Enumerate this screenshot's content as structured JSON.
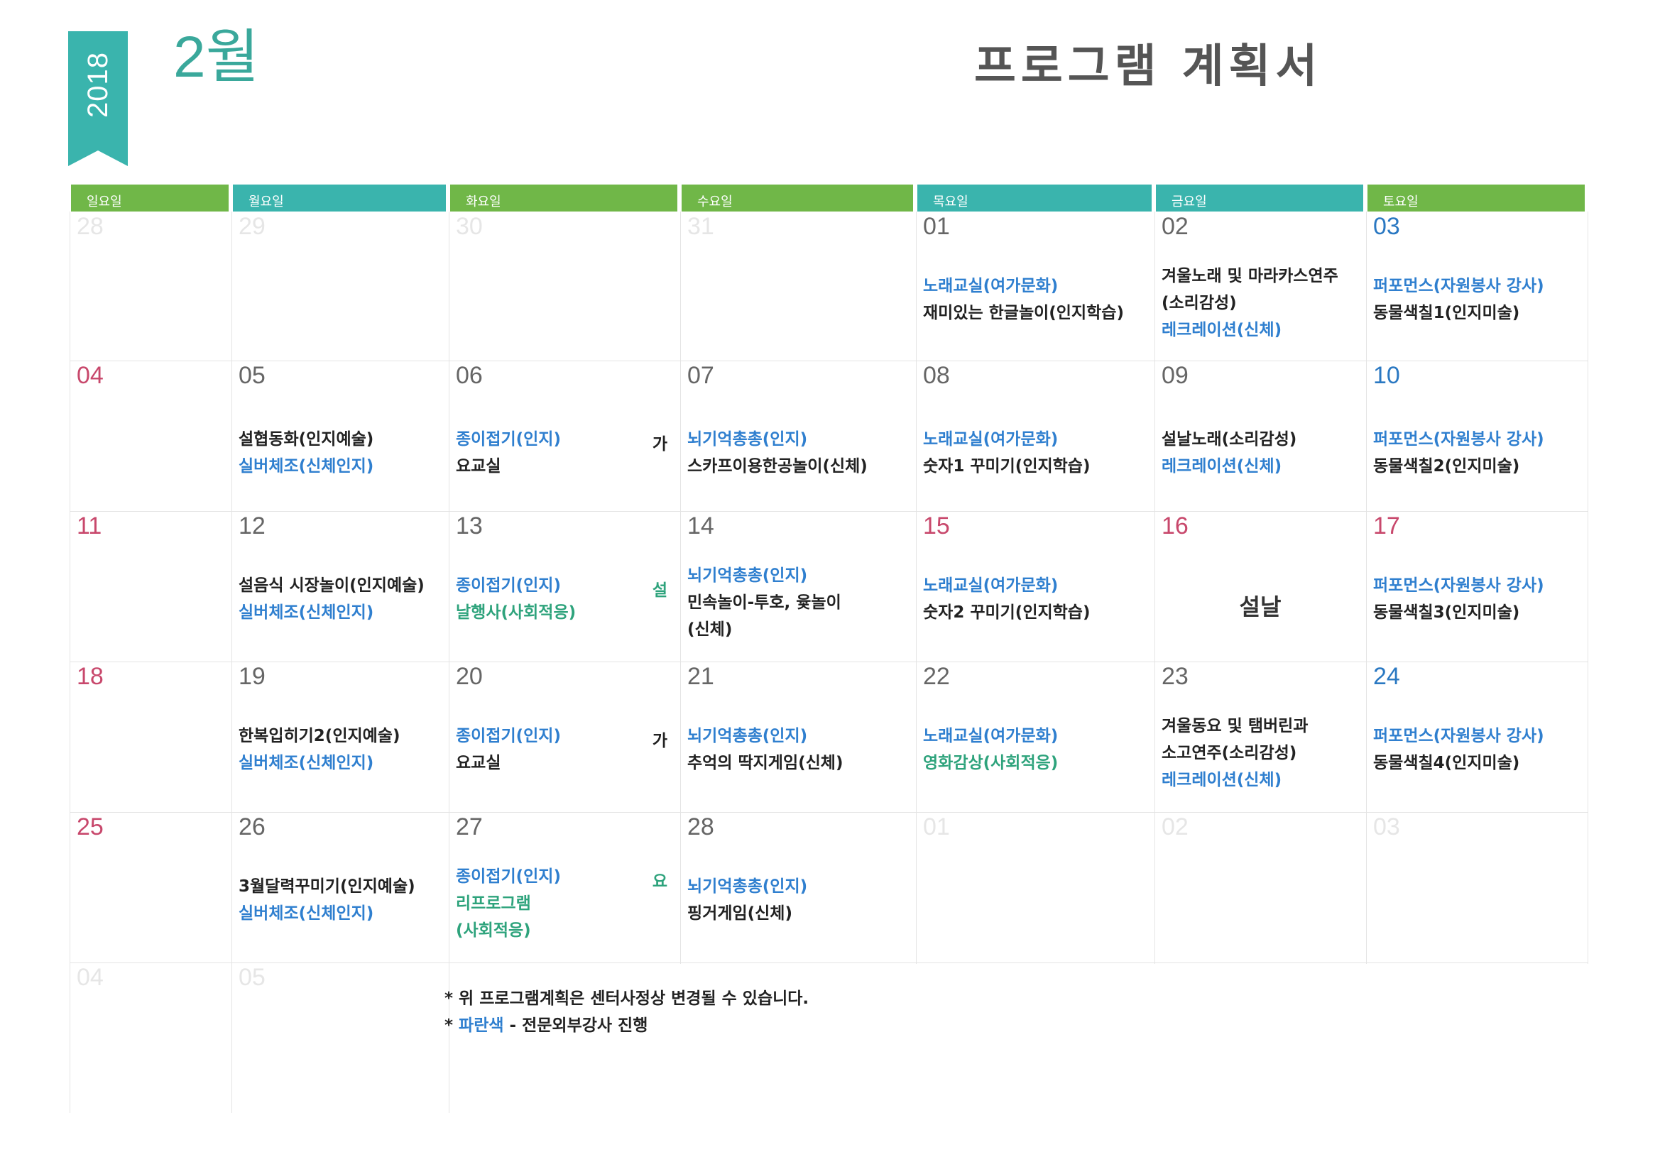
{
  "header": {
    "year": "2018",
    "month": "2월",
    "title": "프로그램 계획서"
  },
  "weekdays": [
    "일요일",
    "월요일",
    "화요일",
    "수요일",
    "목요일",
    "금요일",
    "토요일"
  ],
  "weeks": [
    [
      {
        "day": "28",
        "style": "faint",
        "lines": []
      },
      {
        "day": "29",
        "style": "faint",
        "lines": []
      },
      {
        "day": "30",
        "style": "faint",
        "lines": []
      },
      {
        "day": "31",
        "style": "faint",
        "lines": []
      },
      {
        "day": "01",
        "style": "gray",
        "lines": [
          {
            "t": "노래교실(여가문화)",
            "c": "b"
          },
          {
            "t": "재미있는 한글놀이(인지학습)",
            "c": "k"
          }
        ]
      },
      {
        "day": "02",
        "style": "gray",
        "lines": [
          {
            "t": "겨울노래 및 마라카스연주",
            "c": "k"
          },
          {
            "t": "(소리감성)",
            "c": "k"
          },
          {
            "t": "레크레이션(신체)",
            "c": "b"
          }
        ]
      },
      {
        "day": "03",
        "style": "blue",
        "lines": [
          {
            "t": "퍼포먼스(자원봉사 강사)",
            "c": "b"
          },
          {
            "t": "동물색칠1(인지미술)",
            "c": "k"
          }
        ]
      }
    ],
    [
      {
        "day": "04",
        "style": "red",
        "lines": []
      },
      {
        "day": "05",
        "style": "gray",
        "lines": [
          {
            "t": "설협동화(인지예술)",
            "c": "k"
          },
          {
            "t": "실버체조(신체인지)",
            "c": "b"
          }
        ]
      },
      {
        "day": "06",
        "style": "gray",
        "lines": [
          {
            "t": "종이접기(인지)",
            "c": "b"
          },
          {
            "t": "요교실",
            "c": "k"
          }
        ],
        "side": {
          "t": "가",
          "c": "k"
        }
      },
      {
        "day": "07",
        "style": "gray",
        "lines": [
          {
            "t": "뇌기억총총(인지)",
            "c": "b"
          },
          {
            "t": "스카프이용한공놀이(신체)",
            "c": "k"
          }
        ]
      },
      {
        "day": "08",
        "style": "gray",
        "lines": [
          {
            "t": "노래교실(여가문화)",
            "c": "b"
          },
          {
            "t": "숫자1 꾸미기(인지학습)",
            "c": "k"
          }
        ]
      },
      {
        "day": "09",
        "style": "gray",
        "lines": [
          {
            "t": "설날노래(소리감성)",
            "c": "k"
          },
          {
            "t": "레크레이션(신체)",
            "c": "b"
          }
        ]
      },
      {
        "day": "10",
        "style": "blue",
        "lines": [
          {
            "t": "퍼포먼스(자원봉사 강사)",
            "c": "b"
          },
          {
            "t": "동물색칠2(인지미술)",
            "c": "k"
          }
        ]
      }
    ],
    [
      {
        "day": "11",
        "style": "red",
        "lines": []
      },
      {
        "day": "12",
        "style": "gray",
        "lines": [
          {
            "t": "설음식 시장놀이(인지예술)",
            "c": "k"
          },
          {
            "t": "실버체조(신체인지)",
            "c": "b"
          }
        ]
      },
      {
        "day": "13",
        "style": "gray",
        "lines": [
          {
            "t": "종이접기(인지)",
            "c": "b"
          },
          {
            "t": "날행사(사회적응)",
            "c": "g"
          }
        ],
        "side": {
          "t": "설",
          "c": "g"
        }
      },
      {
        "day": "14",
        "style": "gray",
        "lines": [
          {
            "t": "뇌기억총총(인지)",
            "c": "b"
          },
          {
            "t": "민속놀이-투호, 윷놀이",
            "c": "k"
          },
          {
            "t": "(신체)",
            "c": "k"
          }
        ]
      },
      {
        "day": "15",
        "style": "red",
        "lines": [
          {
            "t": "노래교실(여가문화)",
            "c": "b"
          },
          {
            "t": "숫자2 꾸미기(인지학습)",
            "c": "k"
          }
        ]
      },
      {
        "day": "16",
        "style": "red",
        "lines": [],
        "holiday": "설날"
      },
      {
        "day": "17",
        "style": "red",
        "lines": [
          {
            "t": "퍼포먼스(자원봉사 강사)",
            "c": "b"
          },
          {
            "t": "동물색칠3(인지미술)",
            "c": "k"
          }
        ]
      }
    ],
    [
      {
        "day": "18",
        "style": "red",
        "lines": []
      },
      {
        "day": "19",
        "style": "gray",
        "lines": [
          {
            "t": "한복입히기2(인지예술)",
            "c": "k"
          },
          {
            "t": "실버체조(신체인지)",
            "c": "b"
          }
        ]
      },
      {
        "day": "20",
        "style": "gray",
        "lines": [
          {
            "t": "종이접기(인지)",
            "c": "b"
          },
          {
            "t": "요교실",
            "c": "k"
          }
        ],
        "side": {
          "t": "가",
          "c": "k"
        }
      },
      {
        "day": "21",
        "style": "gray",
        "lines": [
          {
            "t": "뇌기억총총(인지)",
            "c": "b"
          },
          {
            "t": "추억의 딱지게임(신체)",
            "c": "k"
          }
        ]
      },
      {
        "day": "22",
        "style": "gray",
        "lines": [
          {
            "t": "노래교실(여가문화)",
            "c": "b"
          },
          {
            "t": "영화감상(사회적응)",
            "c": "g"
          }
        ]
      },
      {
        "day": "23",
        "style": "gray",
        "lines": [
          {
            "t": "겨울동요 및 탬버린과",
            "c": "k"
          },
          {
            "t": "소고연주(소리감성)",
            "c": "k"
          },
          {
            "t": "레크레이션(신체)",
            "c": "b"
          }
        ]
      },
      {
        "day": "24",
        "style": "blue",
        "lines": [
          {
            "t": "퍼포먼스(자원봉사 강사)",
            "c": "b"
          },
          {
            "t": "동물색칠4(인지미술)",
            "c": "k"
          }
        ]
      }
    ],
    [
      {
        "day": "25",
        "style": "red",
        "lines": []
      },
      {
        "day": "26",
        "style": "gray",
        "lines": [
          {
            "t": "3월달력꾸미기(인지예술)",
            "c": "k"
          },
          {
            "t": "실버체조(신체인지)",
            "c": "b"
          }
        ]
      },
      {
        "day": "27",
        "style": "gray",
        "lines": [
          {
            "t": "종이접기(인지)",
            "c": "b"
          },
          {
            "t": "리프로그램",
            "c": "g"
          },
          {
            "t": "(사회적응)",
            "c": "g"
          }
        ],
        "side": {
          "t": "요",
          "c": "g"
        }
      },
      {
        "day": "28",
        "style": "gray",
        "lines": [
          {
            "t": "뇌기억총총(인지)",
            "c": "b"
          },
          {
            "t": "핑거게임(신체)",
            "c": "k"
          }
        ]
      },
      {
        "day": "01",
        "style": "faint",
        "lines": []
      },
      {
        "day": "02",
        "style": "faint",
        "lines": []
      },
      {
        "day": "03",
        "style": "faint",
        "lines": []
      }
    ],
    [
      {
        "day": "04",
        "style": "faint",
        "lines": []
      },
      {
        "day": "05",
        "style": "faint",
        "lines": []
      }
    ]
  ],
  "notes": {
    "line1": "* 위 프로그램계획은 센터사정상 변경될 수 있습니다.",
    "line2_prefix": "* ",
    "line2_blue": "파란색",
    "line2_suffix": " - 전문외부강사 진행"
  },
  "colors": {
    "teal": "#3ab4ad",
    "green": "#70b748",
    "blue_text": "#2f7fcf",
    "red_date": "#c8486c"
  }
}
